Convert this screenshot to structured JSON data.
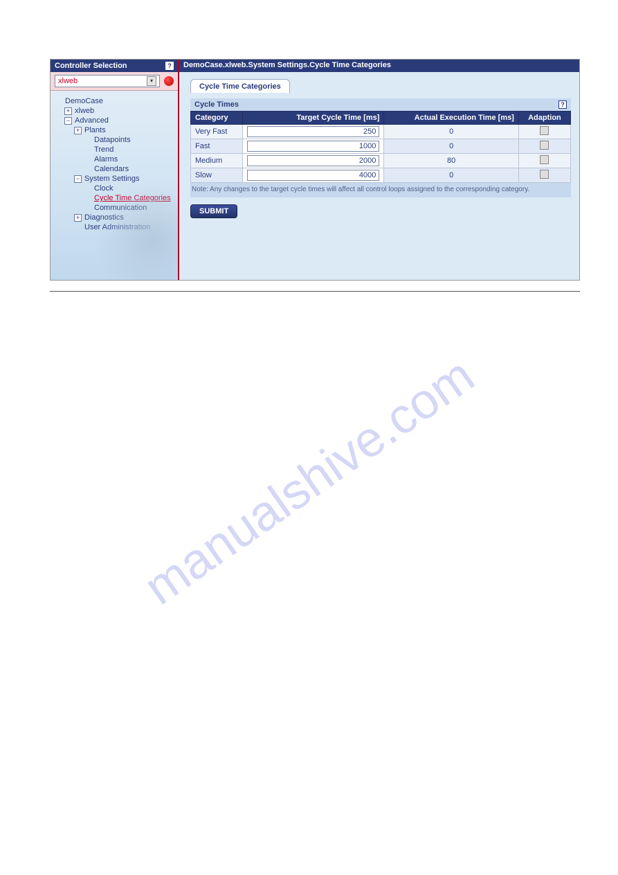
{
  "header": {
    "left_title": "Controller Selection",
    "breadcrumb": "DemoCase.xlweb.System Settings.Cycle Time Categories"
  },
  "selector": {
    "value": "xlweb"
  },
  "tree": {
    "root": "DemoCase",
    "nodes": [
      {
        "label": "xlweb",
        "toggle": "+",
        "depth": 2
      },
      {
        "label": "Advanced",
        "toggle": "−",
        "depth": 2
      },
      {
        "label": "Plants",
        "toggle": "+",
        "depth": 3
      },
      {
        "label": "Datapoints",
        "toggle": "",
        "depth": 4
      },
      {
        "label": "Trend",
        "toggle": "",
        "depth": 4
      },
      {
        "label": "Alarms",
        "toggle": "",
        "depth": 4
      },
      {
        "label": "Calendars",
        "toggle": "",
        "depth": 4
      },
      {
        "label": "System Settings",
        "toggle": "−",
        "depth": 3
      },
      {
        "label": "Clock",
        "toggle": "",
        "depth": 4
      },
      {
        "label": "Cycle Time Categories",
        "toggle": "",
        "depth": 4,
        "selected": true
      },
      {
        "label": "Communication",
        "toggle": "",
        "depth": 4
      },
      {
        "label": "Diagnostics",
        "toggle": "+",
        "depth": 3
      },
      {
        "label": "User Administration",
        "toggle": "",
        "depth": 3
      }
    ]
  },
  "tab": {
    "label": "Cycle Time Categories"
  },
  "panel": {
    "title": "Cycle Times",
    "columns": {
      "category": "Category",
      "target": "Target Cycle Time [ms]",
      "actual": "Actual Execution Time [ms]",
      "adaption": "Adaption"
    },
    "rows": [
      {
        "category": "Very Fast",
        "target": "250",
        "actual": "0"
      },
      {
        "category": "Fast",
        "target": "1000",
        "actual": "0"
      },
      {
        "category": "Medium",
        "target": "2000",
        "actual": "80"
      },
      {
        "category": "Slow",
        "target": "4000",
        "actual": "0"
      }
    ],
    "note": "Note: Any changes to the target cycle times will affect all control loops assigned to the corresponding category."
  },
  "buttons": {
    "submit": "SUBMIT"
  },
  "watermark": "manualshive.com"
}
